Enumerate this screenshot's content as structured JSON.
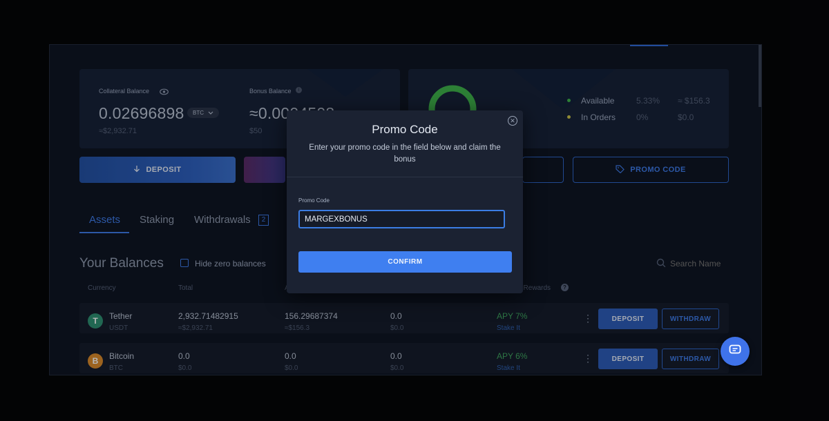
{
  "balances": {
    "collateral_label": "Collateral Balance",
    "collateral_value": "0.02696898",
    "collateral_currency": "BTC",
    "collateral_usd": "≈$2,932.71",
    "bonus_label": "Bonus Balance",
    "bonus_value": "≈0.0004508",
    "bonus_usd": "$50"
  },
  "orders": {
    "available_label": "Available",
    "available_pct": "5.33%",
    "available_usd": "≈ $156.3",
    "inorders_label": "In Orders",
    "inorders_pct": "0%",
    "inorders_usd": "$0.0"
  },
  "actions": {
    "deposit_label": "DEPOSIT",
    "promo_label": "PROMO CODE"
  },
  "tabs": [
    {
      "label": "Assets"
    },
    {
      "label": "Staking"
    },
    {
      "label": "Withdrawals",
      "badge": "2"
    }
  ],
  "list": {
    "heading": "Your Balances",
    "hide_zero_label": "Hide zero balances",
    "search_placeholder": "Search Name",
    "columns": [
      "Currency",
      "Total",
      "A",
      "",
      "al Rewards"
    ],
    "rows": [
      {
        "name": "Tether",
        "symbol": "USDT",
        "coin_glyph": "T",
        "coin_color": "#2f8f72",
        "total": "2,932.71482915",
        "total_usd": "≈$2,932.71",
        "available": "156.29687374",
        "available_usd": "≈$156.3",
        "in_orders": "0.0",
        "in_orders_usd": "$0.0",
        "apy": "APY 7%",
        "stake": "Stake It",
        "deposit": "DEPOSIT",
        "withdraw": "WITHDRAW"
      },
      {
        "name": "Bitcoin",
        "symbol": "BTC",
        "coin_glyph": "B",
        "coin_color": "#d98a2b",
        "total": "0.0",
        "total_usd": "$0.0",
        "available": "0.0",
        "available_usd": "$0.0",
        "in_orders": "0.0",
        "in_orders_usd": "$0.0",
        "apy": "APY 6%",
        "stake": "Stake It",
        "deposit": "DEPOSIT",
        "withdraw": "WITHDRAW"
      }
    ]
  },
  "modal": {
    "title": "Promo Code",
    "description": "Enter your promo code in the field below and claim the bonus",
    "field_label": "Promo Code",
    "field_value": "MARGEXBONUS",
    "confirm_label": "CONFIRM"
  },
  "colors": {
    "accent": "#3f7ff0",
    "green": "#3fb24b",
    "apy_green": "#3fa35f"
  }
}
